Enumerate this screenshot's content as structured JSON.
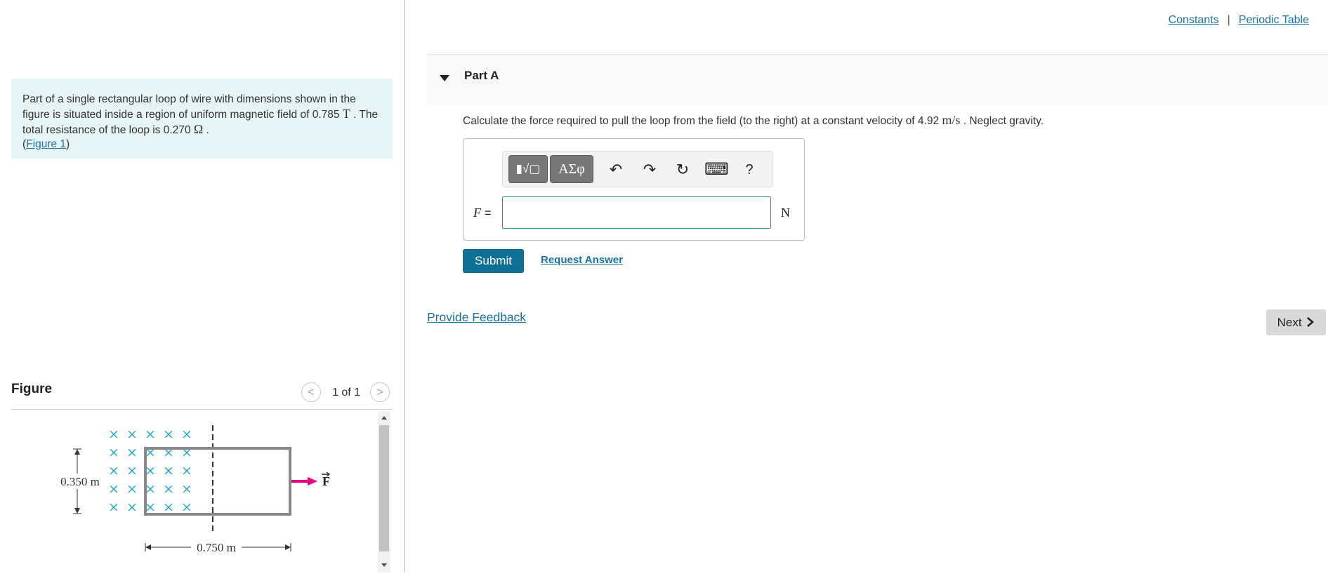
{
  "problem": {
    "text_1": "Part of a single rectangular loop of wire with dimensions shown in the figure is situated inside a region of uniform magnetic field of 0.785 ",
    "field_unit": "T",
    "text_2": " . The total resistance of the loop is 0.270 ",
    "resistance_unit": "Ω",
    "text_3": " .",
    "figure_link_open": "(",
    "figure_link": "Figure 1",
    "figure_link_close": ")"
  },
  "figure_panel": {
    "title": "Figure",
    "prev_icon": "<",
    "next_icon": ">",
    "pager": "1 of 1",
    "height_label": "0.350 m",
    "width_label": "0.750 m",
    "force_label": "F",
    "field_mark": "×"
  },
  "top_links": {
    "constants": "Constants",
    "separator": "|",
    "periodic_table": "Periodic Table"
  },
  "part": {
    "title": "Part A",
    "question_1": "Calculate the force required to pull the loop from the field (to the right) at a constant velocity of 4.92 ",
    "velocity_unit": "m/s",
    "question_2": " . Neglect gravity."
  },
  "answer": {
    "variable": "F",
    "equals": "=",
    "unit": "N",
    "value": "",
    "toolbar": {
      "templates_label": "▮√▢",
      "symbols_label": "ΑΣφ",
      "undo": "↶",
      "redo": "↷",
      "reset": "↻",
      "keyboard": "⌨",
      "help": "?"
    }
  },
  "actions": {
    "submit": "Submit",
    "request_answer": "Request Answer",
    "provide_feedback": "Provide Feedback",
    "next": "Next"
  },
  "colors": {
    "accent": "#0f7096",
    "link": "#1a73a8",
    "problem_bg": "#e6f4f5",
    "field_x": "#29a9d9",
    "force_arrow": "#e6007e"
  }
}
